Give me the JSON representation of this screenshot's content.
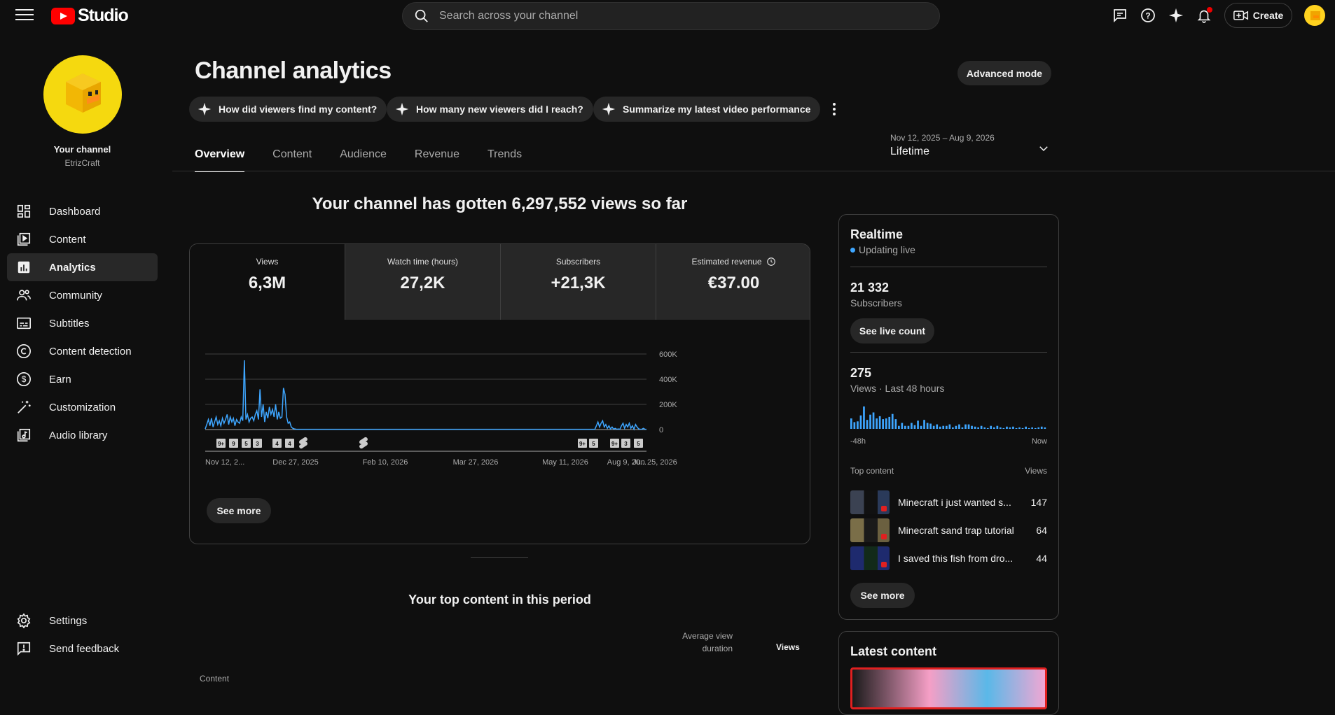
{
  "topbar": {
    "logo_text": "Studio",
    "search_placeholder": "Search across your channel",
    "create_label": "Create"
  },
  "sidebar": {
    "channel_label": "Your channel",
    "channel_handle": "EtrizCraft",
    "items": [
      {
        "label": "Dashboard",
        "icon": "dashboard-icon"
      },
      {
        "label": "Content",
        "icon": "content-icon"
      },
      {
        "label": "Analytics",
        "icon": "analytics-icon",
        "active": true
      },
      {
        "label": "Community",
        "icon": "community-icon"
      },
      {
        "label": "Subtitles",
        "icon": "subtitles-icon"
      },
      {
        "label": "Content detection",
        "icon": "copyright-icon"
      },
      {
        "label": "Earn",
        "icon": "dollar-icon"
      },
      {
        "label": "Customization",
        "icon": "magic-wand-icon"
      },
      {
        "label": "Audio library",
        "icon": "audio-library-icon"
      }
    ],
    "bottom": [
      {
        "label": "Settings",
        "icon": "gear-icon"
      },
      {
        "label": "Send feedback",
        "icon": "feedback-icon"
      }
    ]
  },
  "main": {
    "title": "Channel analytics",
    "advanced_mode": "Advanced mode",
    "chips": [
      "How did viewers find my content?",
      "How many new viewers did I reach?",
      "Summarize my latest video performance"
    ],
    "tabs": [
      "Overview",
      "Content",
      "Audience",
      "Revenue",
      "Trends"
    ],
    "date_range": {
      "sub": "Nov 12, 2025 – Aug 9, 2026",
      "main": "Lifetime"
    },
    "headline": "Your channel has gotten 6,297,552 views so far",
    "metrics": [
      {
        "label": "Views",
        "value": "6,3M"
      },
      {
        "label": "Watch time (hours)",
        "value": "27,2K"
      },
      {
        "label": "Subscribers",
        "value": "+21,3K"
      },
      {
        "label": "Estimated revenue",
        "value": "€37.00"
      }
    ],
    "see_more": "See more",
    "top_content_title": "Your top content in this period",
    "table_headers": {
      "content": "Content",
      "avd": "Average view duration",
      "views": "Views"
    }
  },
  "chart_data": {
    "type": "line",
    "x_ticks": [
      "Nov 12, 2...",
      "Dec 27, 2025",
      "Feb 10, 2026",
      "Mar 27, 2026",
      "May 11, 2026",
      "Jun 25, 2026",
      "Aug 9, 20..."
    ],
    "y_ticks": [
      "600K",
      "400K",
      "200K",
      "0"
    ],
    "ylim": [
      0,
      600000
    ],
    "color": "#3ea6ff",
    "series": [
      {
        "values": [
          5000,
          40000,
          80000,
          30000,
          90000,
          20000,
          60000,
          100000,
          40000,
          70000,
          30000,
          90000,
          50000,
          80000,
          120000,
          40000,
          100000,
          60000,
          90000,
          30000,
          80000,
          60000,
          50000,
          100000,
          70000,
          550000,
          80000,
          120000,
          60000,
          90000,
          100000,
          70000,
          120000,
          150000,
          80000,
          320000,
          100000,
          200000,
          60000,
          140000,
          90000,
          180000,
          120000,
          160000,
          100000,
          200000,
          80000,
          140000,
          90000,
          100000,
          330000,
          280000,
          100000,
          50000,
          60000,
          20000,
          10000,
          5000,
          3000,
          2000,
          2000,
          2000,
          2000,
          2000,
          2000,
          2000,
          2000,
          2000,
          2000,
          2000,
          2000,
          2000,
          2000,
          2000,
          2000,
          2000,
          2000,
          2000,
          2000,
          2000,
          2000,
          2000,
          2000,
          2000,
          2000,
          2000,
          2000,
          2000,
          2000,
          2000,
          2000,
          2000,
          2000,
          2000,
          2000,
          2000,
          2000,
          2000,
          2000,
          2000,
          2000,
          2000,
          2000,
          2000,
          2000,
          2000,
          2000,
          2000,
          2000,
          2000,
          2000,
          2000,
          2000,
          2000,
          2000,
          2000,
          2000,
          2000,
          2000,
          2000,
          2000,
          2000,
          2000,
          2000,
          2000,
          2000,
          2000,
          2000,
          2000,
          2000,
          2000,
          2000,
          2000,
          2000,
          2000,
          2000,
          2000,
          2000,
          2000,
          2000,
          2000,
          2000,
          2000,
          2000,
          2000,
          2000,
          2000,
          2000,
          2000,
          2000,
          2000,
          2000,
          2000,
          2000,
          2000,
          2000,
          2000,
          2000,
          2000,
          2000,
          2000,
          2000,
          2000,
          2000,
          2000,
          2000,
          2000,
          2000,
          2000,
          2000,
          2000,
          2000,
          2000,
          2000,
          2000,
          2000,
          2000,
          2000,
          2000,
          2000,
          2000,
          2000,
          2000,
          2000,
          2000,
          2000,
          2000,
          2000,
          2000,
          2000,
          2000,
          2000,
          2000,
          2000,
          2000,
          2000,
          2000,
          2000,
          2000,
          2000,
          2000,
          2000,
          2000,
          2000,
          2000,
          2000,
          2000,
          2000,
          2000,
          2000,
          2000,
          2000,
          2000,
          2000,
          2000,
          2000,
          2000,
          2000,
          2000,
          2000,
          2000,
          2000,
          2000,
          2000,
          2000,
          2000,
          2000,
          2000,
          2000,
          2000,
          2000,
          2000,
          2000,
          2000,
          2000,
          2000,
          2000,
          2000,
          2000,
          2000,
          2000,
          2000,
          2000,
          2000,
          2000,
          2000,
          2000,
          2000,
          2000,
          2000,
          30000,
          60000,
          20000,
          50000,
          70000,
          20000,
          40000,
          10000,
          30000,
          5000,
          20000,
          3000,
          10000,
          2000,
          5000,
          2000,
          30000,
          50000,
          10000,
          40000,
          20000,
          50000,
          10000,
          30000,
          2000,
          40000,
          20000,
          5000,
          3000,
          2000,
          10000,
          3000,
          2000
        ]
      }
    ],
    "markers": [
      "9+",
      "9",
      "5",
      "3",
      "4",
      "4",
      "shorts",
      "shorts",
      "9+",
      "5",
      "9+",
      "3",
      "5"
    ]
  },
  "realtime": {
    "title": "Realtime",
    "live": "Updating live",
    "subscribers": "21 332",
    "subscribers_label": "Subscribers",
    "see_live_count": "See live count",
    "views": "275",
    "views_label": "Views · Last 48 hours",
    "axis_left": "-48h",
    "axis_right": "Now",
    "bar_values": [
      14,
      9,
      10,
      18,
      30,
      12,
      19,
      22,
      14,
      17,
      13,
      14,
      16,
      20,
      13,
      4,
      8,
      4,
      4,
      8,
      5,
      11,
      4,
      12,
      8,
      7,
      4,
      6,
      3,
      4,
      4,
      6,
      2,
      4,
      6,
      2,
      6,
      6,
      4,
      3,
      2,
      4,
      2,
      1,
      4,
      2,
      4,
      2,
      1,
      3,
      2,
      3,
      1,
      2,
      1,
      3,
      1,
      2,
      1,
      2,
      3,
      2
    ],
    "top_content_label": "Top content",
    "views_col": "Views",
    "top_content": [
      {
        "title": "Minecraft i just wanted s...",
        "views": "147"
      },
      {
        "title": "Minecraft sand trap tutorial",
        "views": "64"
      },
      {
        "title": "I saved this fish from dro...",
        "views": "44"
      }
    ],
    "see_more": "See more"
  },
  "latest": {
    "title": "Latest content"
  }
}
